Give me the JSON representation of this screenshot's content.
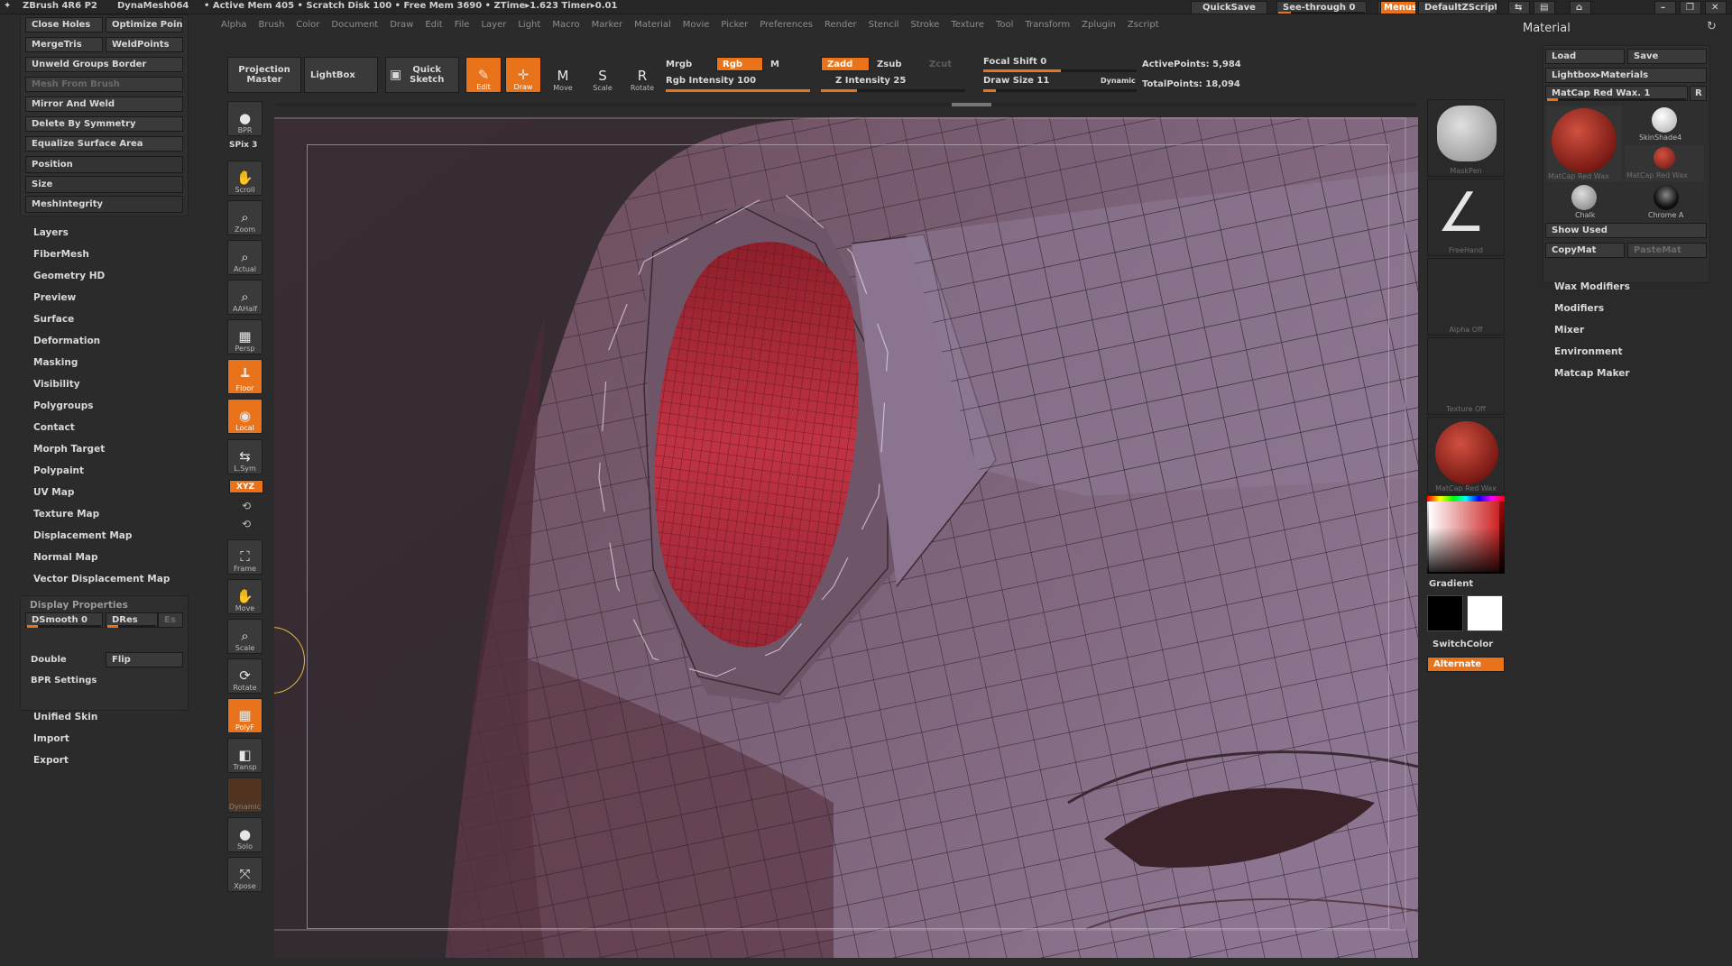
{
  "titlebar": {
    "app": "ZBrush 4R6 P2",
    "mesh": "DynaMesh064",
    "stats": "• Active Mem 405 • Scratch Disk 100 • Free Mem 3690 • ZTime▸1.623 Timer▸0.01",
    "quicksave": "QuickSave",
    "seethrough": "See-through  0",
    "menus": "Menus",
    "script": "DefaultZScript"
  },
  "menubar": [
    "Alpha",
    "Brush",
    "Color",
    "Document",
    "Draw",
    "Edit",
    "File",
    "Layer",
    "Light",
    "Macro",
    "Marker",
    "Material",
    "Movie",
    "Picker",
    "Preferences",
    "Render",
    "Stencil",
    "Stroke",
    "Texture",
    "Tool",
    "Transform",
    "Zplugin",
    "Zscript"
  ],
  "leftpanel": {
    "top_buttons": [
      [
        "Close Holes",
        "Optimize Poin"
      ],
      [
        "MergeTris",
        "WeldPoints"
      ]
    ],
    "wide_buttons": [
      "Unweld Groups Border",
      "Mesh From Brush",
      "Mirror And Weld",
      "Delete By Symmetry",
      "Equalize Surface Area"
    ],
    "sub_items": [
      "Position",
      "Size",
      "MeshIntegrity"
    ],
    "menu_items": [
      "Layers",
      "FiberMesh",
      "Geometry HD",
      "Preview",
      "Surface",
      "Deformation",
      "Masking",
      "Visibility",
      "Polygroups",
      "Contact",
      "Morph Target",
      "Polypaint",
      "UV Map",
      "Texture Map",
      "Displacement Map",
      "Normal Map",
      "Vector Displacement Map"
    ],
    "display_properties": {
      "title": "Display Properties",
      "dsmooth": "DSmooth 0",
      "dres": "DRes",
      "es": "Es",
      "double": "Double",
      "flip": "Flip",
      "bpr": "BPR Settings"
    },
    "bottom_items": [
      "Unified Skin",
      "Import",
      "Export"
    ]
  },
  "toptoolbar": {
    "projection_master": "Projection Master",
    "lightbox": "LightBox",
    "quick_sketch": "Quick Sketch",
    "edit": "Edit",
    "draw": "Draw",
    "move": "Move",
    "scale": "Scale",
    "rotate": "Rotate",
    "mrgb": "Mrgb",
    "rgb": "Rgb",
    "m": "M",
    "rgb_intensity": "Rgb Intensity 100",
    "zadd": "Zadd",
    "zsub": "Zsub",
    "zcut": "Zcut",
    "z_intensity": "Z Intensity 25",
    "focal_shift": "Focal Shift 0",
    "draw_size": "Draw Size 11",
    "dynamic": "Dynamic",
    "active_points": "ActivePoints: 5,984",
    "total_points": "TotalPoints: 18,094",
    "rgb_intensity_value": 100,
    "z_intensity_value": 25,
    "draw_size_value": 11
  },
  "lefttools": [
    {
      "cap": "BPR",
      "glyph": "●",
      "orange": false
    },
    {
      "cap": "Scroll",
      "glyph": "✋",
      "orange": false
    },
    {
      "cap": "Zoom",
      "glyph": "⌕",
      "orange": false
    },
    {
      "cap": "Actual",
      "glyph": "⌕",
      "orange": false
    },
    {
      "cap": "AAHalf",
      "glyph": "⌕",
      "orange": false
    },
    {
      "cap": "Persp",
      "glyph": "▦",
      "orange": false
    },
    {
      "cap": "Floor",
      "glyph": "┻",
      "orange": true
    },
    {
      "cap": "Local",
      "glyph": "◉",
      "orange": true
    },
    {
      "cap": "L.Sym",
      "glyph": "⇆",
      "orange": false
    },
    {
      "cap": "Frame",
      "glyph": "⛶",
      "orange": false
    },
    {
      "cap": "Move",
      "glyph": "✋",
      "orange": false
    },
    {
      "cap": "Scale",
      "glyph": "⌕",
      "orange": false
    },
    {
      "cap": "Rotate",
      "glyph": "⟳",
      "orange": false
    },
    {
      "cap": "PolyF",
      "glyph": "▦",
      "orange": true
    },
    {
      "cap": "Transp",
      "glyph": "◧",
      "orange": false
    },
    {
      "cap": "Dynamic",
      "glyph": "",
      "orange": false
    },
    {
      "cap": "Solo",
      "glyph": "●",
      "orange": false
    },
    {
      "cap": "Xpose",
      "glyph": "⤧",
      "orange": false
    }
  ],
  "spix": "SPix 3",
  "xyz": "XYZ",
  "righttools": {
    "maskpen": "MaskPen",
    "freehand": "FreeHand",
    "alpha_off": "Alpha Off",
    "texture_off": "Texture Off",
    "matcap": "MatCap Red Wax",
    "gradient": "Gradient",
    "switchcolor": "SwitchColor",
    "alternate": "Alternate"
  },
  "material": {
    "title": "Material",
    "load": "Load",
    "save": "Save",
    "lightbox": "Lightbox▸Materials",
    "current": "MatCap Red Wax. 1",
    "r": "R",
    "skinshade": "SkinShade4",
    "matcap1": "MatCap Red Wax",
    "matcap2": "MatCap Red Wax",
    "chalk": "Chalk",
    "chrome": "Chrome A",
    "show_used": "Show Used",
    "copymat": "CopyMat",
    "pastemat": "PasteMat",
    "items": [
      "Wax Modifiers",
      "Modifiers",
      "Mixer",
      "Environment",
      "Matcap Maker"
    ]
  },
  "colors": {
    "accent": "#e8731a",
    "panel": "#2b2b2b",
    "mesh_base": "#5e4a58",
    "mesh_red": "#b2283a"
  }
}
